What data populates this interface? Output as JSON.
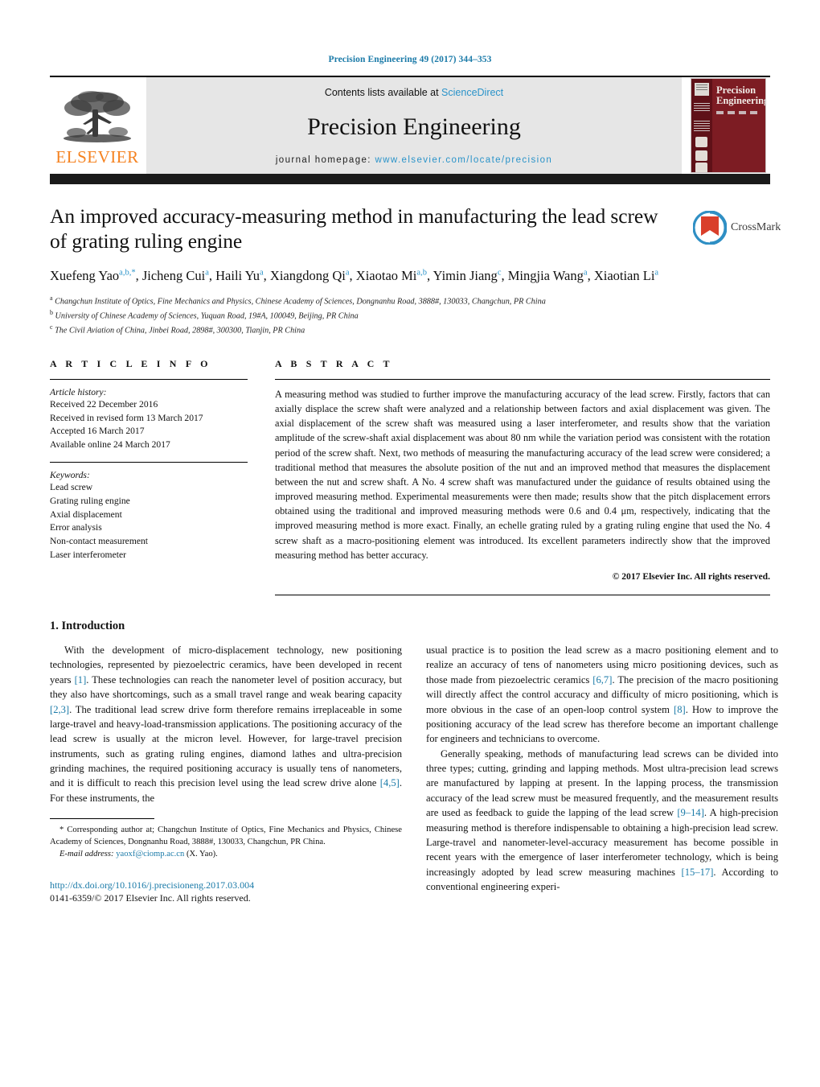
{
  "running_head": "Precision Engineering 49 (2017) 344–353",
  "masthead": {
    "publisher": "ELSEVIER",
    "contents_prefix": "Contents lists available at ",
    "contents_link": "ScienceDirect",
    "journal_title": "Precision Engineering",
    "homepage_prefix": "journal homepage: ",
    "homepage_url": "www.elsevier.com/locate/precision",
    "cover_title_line1": "Precision",
    "cover_title_line2": "Engineering"
  },
  "article": {
    "title": "An improved accuracy-measuring method in manufacturing the lead screw of grating ruling engine",
    "authors_html": "Xuefeng Yao<sup>a,b,</sup><sup class=\"star\">*</sup>, Jicheng Cui<sup>a</sup>, Haili Yu<sup>a</sup>, Xiangdong Qi<sup>a</sup>, Xiaotao Mi<sup>a,b</sup>, Yimin Jiang<sup>c</sup>, Mingjia Wang<sup>a</sup>, Xiaotian Li<sup>a</sup>",
    "affiliations": [
      {
        "marker": "a",
        "text": "Changchun Institute of Optics, Fine Mechanics and Physics, Chinese Academy of Sciences, Dongnanhu Road, 3888#, 130033, Changchun, PR China"
      },
      {
        "marker": "b",
        "text": "University of Chinese Academy of Sciences, Yuquan Road, 19#A, 100049, Beijing, PR China"
      },
      {
        "marker": "c",
        "text": "The Civil Aviation of China, Jinbei Road, 2898#, 300300, Tianjin, PR China"
      }
    ],
    "crossmark_label": "CrossMark"
  },
  "article_info": {
    "heading": "A R T I C L E   I N F O",
    "history_label": "Article history:",
    "history": [
      "Received 22 December 2016",
      "Received in revised form 13 March 2017",
      "Accepted 16 March 2017",
      "Available online 24 March 2017"
    ],
    "keywords_label": "Keywords:",
    "keywords": [
      "Lead screw",
      "Grating ruling engine",
      "Axial displacement",
      "Error analysis",
      "Non-contact measurement",
      "Laser interferometer"
    ]
  },
  "abstract": {
    "heading": "A B S T R A C T",
    "text": "A measuring method was studied to further improve the manufacturing accuracy of the lead screw. Firstly, factors that can axially displace the screw shaft were analyzed and a relationship between factors and axial displacement was given. The axial displacement of the screw shaft was measured using a laser interferometer, and results show that the variation amplitude of the screw-shaft axial displacement was about 80 nm while the variation period was consistent with the rotation period of the screw shaft. Next, two methods of measuring the manufacturing accuracy of the lead screw were considered; a traditional method that measures the absolute position of the nut and an improved method that measures the displacement between the nut and screw shaft. A No. 4 screw shaft was manufactured under the guidance of results obtained using the improved measuring method. Experimental measurements were then made; results show that the pitch displacement errors obtained using the traditional and improved measuring methods were 0.6 and 0.4 μm, respectively, indicating that the improved measuring method is more exact. Finally, an echelle grating ruled by a grating ruling engine that used the No. 4 screw shaft as a macro-positioning element was introduced. Its excellent parameters indirectly show that the improved measuring method has better accuracy.",
    "copyright": "© 2017 Elsevier Inc. All rights reserved."
  },
  "introduction": {
    "section_number_title": "1.  Introduction",
    "left_paragraph_html": "With the development of micro-displacement technology, new positioning technologies, represented by piezoelectric ceramics, have been developed in recent years <span class=\"ref\">[1]</span>. These technologies can reach the nanometer level of position accuracy, but they also have shortcomings, such as a small travel range and weak bearing capacity <span class=\"ref\">[2,3]</span>. The traditional lead screw drive form therefore remains irreplaceable in some large-travel and heavy-load-transmission applications. The positioning accuracy of the lead screw is usually at the micron level. However, for large-travel precision instruments, such as grating ruling engines, diamond lathes and ultra-precision grinding machines, the required positioning accuracy is usually tens of nanometers, and it is difficult to reach this precision level using the lead screw drive alone <span class=\"ref\">[4,5]</span>. For these instruments, the",
    "right_paragraph1_html": "usual practice is to position the lead screw as a macro positioning element and to realize an accuracy of tens of nanometers using micro positioning devices, such as those made from piezoelectric ceramics <span class=\"ref\">[6,7]</span>. The precision of the macro positioning will directly affect the control accuracy and difficulty of micro positioning, which is more obvious in the case of an open-loop control system <span class=\"ref\">[8]</span>. How to improve the positioning accuracy of the lead screw has therefore become an important challenge for engineers and technicians to overcome.",
    "right_paragraph2_html": "Generally speaking, methods of manufacturing lead screws can be divided into three types; cutting, grinding and lapping methods. Most ultra-precision lead screws are manufactured by lapping at present. In the lapping process, the transmission accuracy of the lead screw must be measured frequently, and the measurement results are used as feedback to guide the lapping of the lead screw <span class=\"ref\">[9–14]</span>. A high-precision measuring method is therefore indispensable to obtaining a high-precision lead screw. Large-travel and nanometer-level-accuracy measurement has become possible in recent years with the emergence of laser interferometer technology, which is being increasingly adopted by lead screw measuring machines <span class=\"ref\">[15–17]</span>. According to conventional engineering experi-"
  },
  "footnotes": {
    "corresponding_html": "*  Corresponding author at; Changchun Institute of Optics, Fine Mechanics and Physics, Chinese Academy of Sciences, Dongnanhu Road, 3888#, 130033, Changchun, PR China.",
    "email_label": "E-mail address:",
    "email": "yaoxf@ciomp.ac.cn",
    "email_suffix": "(X. Yao).",
    "doi": "http://dx.doi.org/10.1016/j.precisioneng.2017.03.004",
    "issn_line": "0141-6359/© 2017 Elsevier Inc. All rights reserved."
  },
  "colors": {
    "link_blue": "#1a7aa8",
    "sciencedirect_blue": "#2a93c9",
    "elsevier_orange": "#F58220",
    "cover_red": "#7d1c23",
    "masthead_grey": "#e6e6e6"
  }
}
